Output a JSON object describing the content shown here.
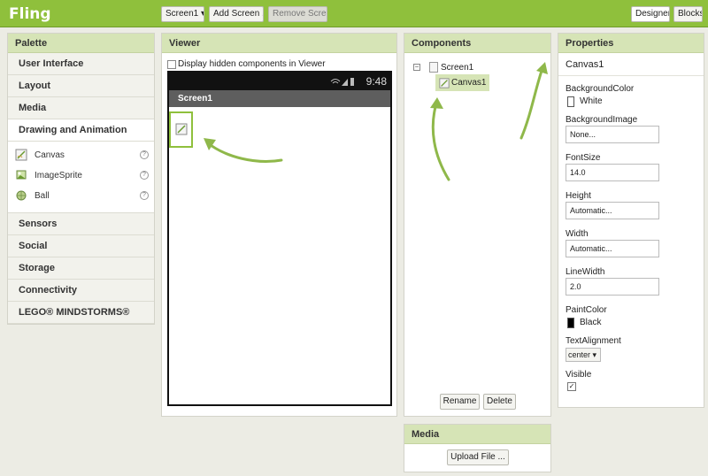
{
  "app": {
    "title": "Fling"
  },
  "toolbar": {
    "screen_select": "Screen1 ▾",
    "add_screen": "Add Screen ...",
    "remove_screen": "Remove Screen",
    "designer": "Designer",
    "blocks": "Blocks"
  },
  "palette": {
    "title": "Palette",
    "categories_top": [
      "User Interface",
      "Layout",
      "Media",
      "Drawing and Animation"
    ],
    "items": [
      {
        "label": "Canvas",
        "icon": "canvas-icon"
      },
      {
        "label": "ImageSprite",
        "icon": "imagesprite-icon"
      },
      {
        "label": "Ball",
        "icon": "ball-icon"
      }
    ],
    "help_glyph": "?",
    "categories_bottom": [
      "Sensors",
      "Social",
      "Storage",
      "Connectivity",
      "LEGO® MINDSTORMS®"
    ]
  },
  "viewer": {
    "title": "Viewer",
    "hidden_checkbox_label": "Display hidden components in Viewer",
    "status_time": "9:48",
    "screen_title": "Screen1"
  },
  "components": {
    "title": "Components",
    "root": "Screen1",
    "child": "Canvas1",
    "rename": "Rename",
    "delete": "Delete"
  },
  "media": {
    "title": "Media",
    "upload": "Upload File ..."
  },
  "properties": {
    "title": "Properties",
    "component": "Canvas1",
    "background_color_label": "BackgroundColor",
    "background_color_value": "White",
    "background_image_label": "BackgroundImage",
    "background_image_value": "None...",
    "font_size_label": "FontSize",
    "font_size_value": "14.0",
    "height_label": "Height",
    "height_value": "Automatic...",
    "width_label": "Width",
    "width_value": "Automatic...",
    "line_width_label": "LineWidth",
    "line_width_value": "2.0",
    "paint_color_label": "PaintColor",
    "paint_color_value": "Black",
    "text_alignment_label": "TextAlignment",
    "text_alignment_value": "center ▾",
    "visible_label": "Visible",
    "visible_check": "✓"
  },
  "colors": {
    "topbar": "#8fc03c",
    "panel_header": "#d6e4b6",
    "arrow": "#8fb84a"
  }
}
